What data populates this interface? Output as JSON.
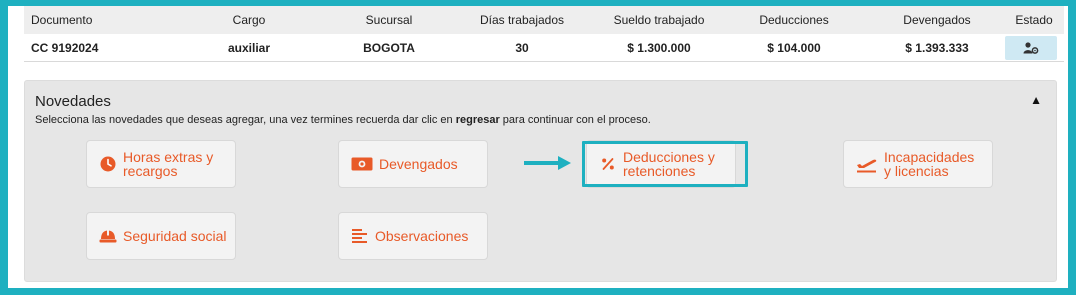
{
  "table": {
    "headers": [
      "Documento",
      "Cargo",
      "Sucursal",
      "Días trabajados",
      "Sueldo trabajado",
      "Deducciones",
      "Devengados",
      "Estado"
    ],
    "row": {
      "documento": "CC 9192024",
      "cargo": "auxiliar",
      "sucursal": "BOGOTA",
      "dias": "30",
      "sueldo": "$ 1.300.000",
      "deducciones": "$ 104.000",
      "devengados": "$ 1.393.333",
      "estado_icon": "user-gear-icon"
    }
  },
  "novedades": {
    "title": "Novedades",
    "subtitle_pre": "Selecciona las novedades que deseas agregar, una vez termines recuerda dar clic en ",
    "subtitle_bold": "regresar",
    "subtitle_post": " para continuar con el proceso.",
    "collapse_icon": "▲",
    "cards": {
      "horas": "Horas extras y recargos",
      "devengados": "Devengados",
      "deducciones": "Deducciones y retenciones",
      "incapacidades": "Incapacidades y licencias",
      "seguridad": "Seguridad social",
      "observaciones": "Observaciones"
    }
  },
  "colors": {
    "accent": "#e85a28",
    "frame": "#1eb0c0",
    "estado_bg": "#cfe9f3"
  }
}
